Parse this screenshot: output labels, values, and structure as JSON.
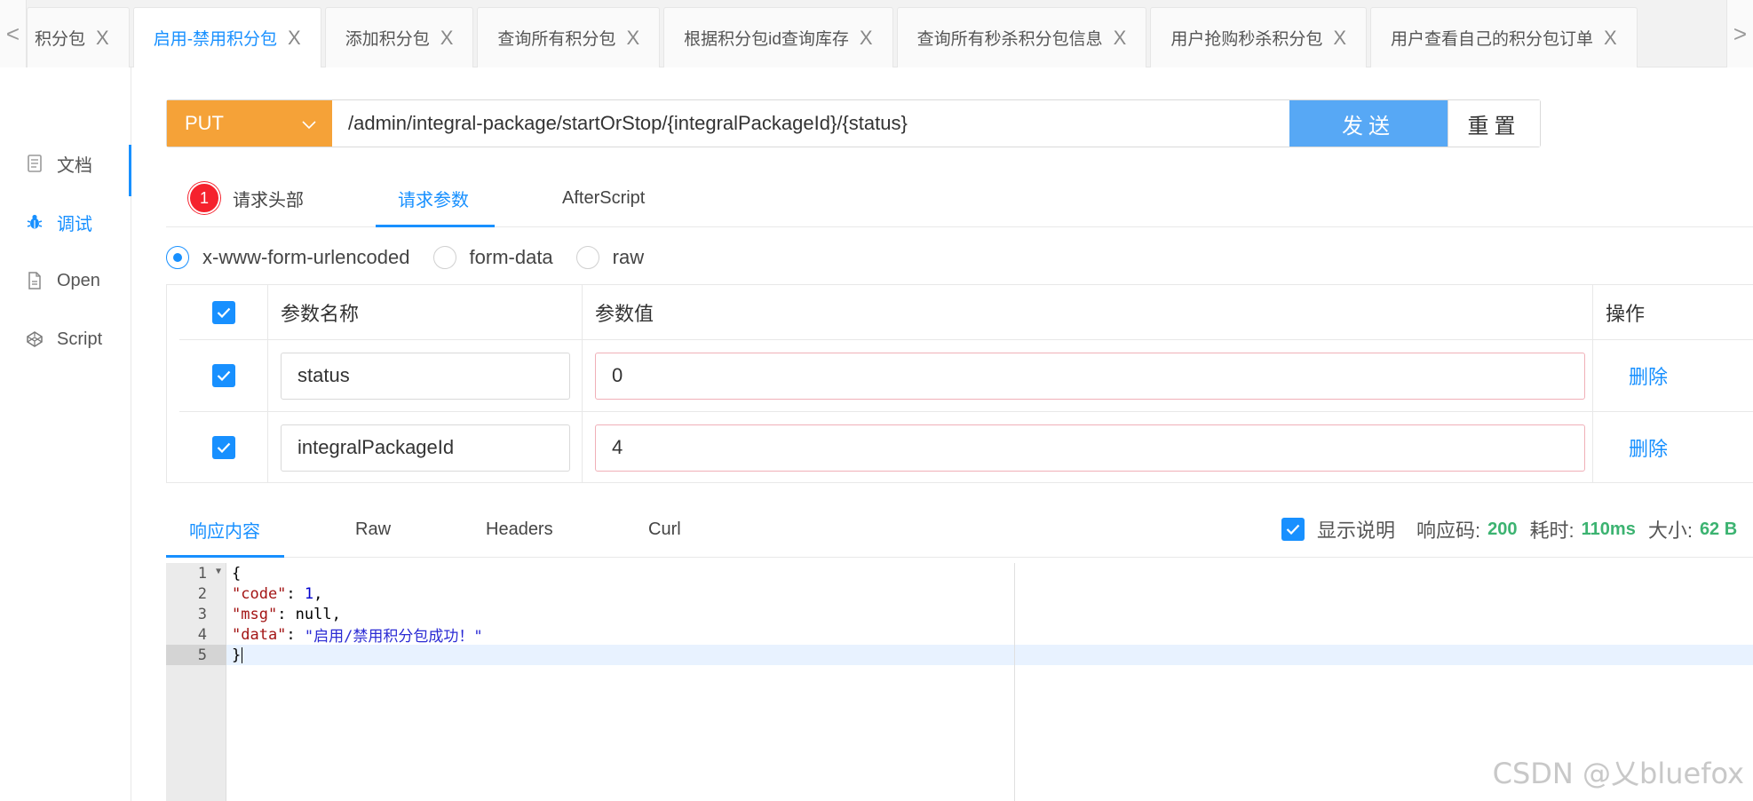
{
  "tabbar": {
    "left_arrow": "<",
    "right_arrow": ">",
    "tabs": [
      {
        "label": "积分包",
        "active": false
      },
      {
        "label": "启用-禁用积分包",
        "active": true
      },
      {
        "label": "添加积分包",
        "active": false
      },
      {
        "label": "查询所有积分包",
        "active": false
      },
      {
        "label": "根据积分包id查询库存",
        "active": false
      },
      {
        "label": "查询所有秒杀积分包信息",
        "active": false
      },
      {
        "label": "用户抢购秒杀积分包",
        "active": false
      },
      {
        "label": "用户查看自己的积分包订单",
        "active": false
      }
    ],
    "close_glyph": "X"
  },
  "sidebar": {
    "items": [
      {
        "label": "文档",
        "icon": "document-icon"
      },
      {
        "label": "调试",
        "icon": "bug-icon",
        "active": true
      },
      {
        "label": "Open",
        "icon": "file-icon"
      },
      {
        "label": "Script",
        "icon": "codepen-icon"
      }
    ]
  },
  "request": {
    "method": "PUT",
    "url": "/admin/integral-package/startOrStop/{integralPackageId}/{status}",
    "send_label": "发送",
    "reset_label": "重置"
  },
  "req_tabs": {
    "headers_badge": "1",
    "headers_label": "请求头部",
    "params_label": "请求参数",
    "afterscript_label": "AfterScript"
  },
  "body_type": {
    "options": [
      "x-www-form-urlencoded",
      "form-data",
      "raw"
    ],
    "selected": "x-www-form-urlencoded"
  },
  "params": {
    "col_name": "参数名称",
    "col_value": "参数值",
    "col_op": "操作",
    "rows": [
      {
        "name": "status",
        "value": "0",
        "op": "删除"
      },
      {
        "name": "integralPackageId",
        "value": "4",
        "op": "删除"
      }
    ]
  },
  "response": {
    "tabs": [
      "响应内容",
      "Raw",
      "Headers",
      "Curl"
    ],
    "show_desc_label": "显示说明",
    "code_label": "响应码:",
    "code_value": "200",
    "time_label": "耗时:",
    "time_value": "110ms",
    "size_label": "大小:",
    "size_value": "62 B",
    "lines": [
      "1",
      "2",
      "3",
      "4",
      "5"
    ],
    "json": {
      "open": "{",
      "code_key": "\"code\"",
      "code_val": "1",
      "msg_key": "\"msg\"",
      "msg_val": "null",
      "data_key": "\"data\"",
      "data_val": "\"启用/禁用积分包成功！\"",
      "close": "}"
    }
  },
  "watermark": "CSDN @乂bluefox",
  "colors": {
    "accent": "#1890ff",
    "method_bg": "#f5a238",
    "send_bg": "#57a8f5",
    "status_green": "#3cb371",
    "badge_red": "#f5222d"
  }
}
